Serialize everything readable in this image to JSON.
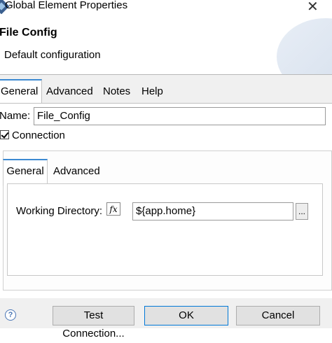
{
  "window": {
    "title": "Global Element Properties",
    "close_glyph": "✕"
  },
  "header": {
    "title": "File Config",
    "description": "Default configuration"
  },
  "tabs": [
    {
      "label": "General",
      "active": true
    },
    {
      "label": "Advanced",
      "active": false
    },
    {
      "label": "Notes",
      "active": false
    },
    {
      "label": "Help",
      "active": false
    }
  ],
  "form": {
    "name_label": "Name:",
    "name_value": "File_Config",
    "connection_label": "Connection",
    "connection_checked": true
  },
  "inner_tabs": [
    {
      "label": "General",
      "active": true
    },
    {
      "label": "Advanced",
      "active": false
    }
  ],
  "working_directory": {
    "label": "Working Directory:",
    "fx_glyph": "fx",
    "value": "${app.home}",
    "browse_label": "..."
  },
  "footer": {
    "help_glyph": "?",
    "test_connection_label": "Test Connection...",
    "ok_label": "OK",
    "cancel_label": "Cancel"
  },
  "colors": {
    "accent": "#3c8ad2",
    "dialog_bg": "#f0f0f0",
    "button_bg": "#e1e1e1"
  }
}
